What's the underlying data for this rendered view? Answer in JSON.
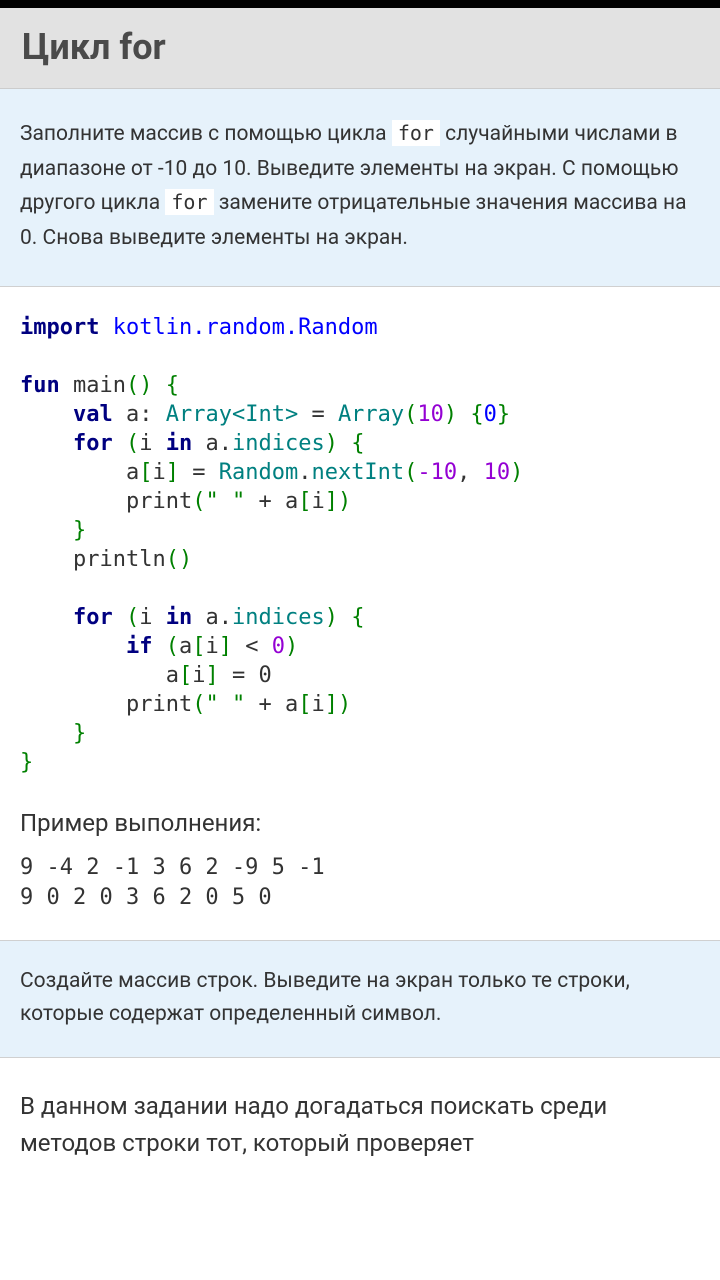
{
  "header": {
    "title": "Цикл for"
  },
  "task1": {
    "part1": "Заполните массив с помощью цикла ",
    "kw1": "for",
    "part2": " случайными числами в диапазоне от -10 до 10. Выведите элементы на экран. С помощью другого цикла ",
    "kw2": "for",
    "part3": " замените отрицательные значения массива на 0. Снова выведите элементы на экран."
  },
  "code": {
    "import": "import",
    "pkg": "kotlin.random.Random",
    "fun": "fun",
    "main": "main",
    "lp": "(",
    "rp": ")",
    "lb": "{",
    "rb": "}",
    "val": "val",
    "a": "a",
    "colon": ":",
    "ArrayInt": "Array<Int>",
    "eq": "=",
    "Array": "Array",
    "ten": "10",
    "zero": "0",
    "for": "for",
    "i": "i",
    "in": "in",
    "dot": ".",
    "indices": "indices",
    "Random": "Random",
    "nextInt": "nextInt",
    "negten": "-10",
    "comma": ",",
    "print": "print",
    "space_str": "\" \"",
    "plus": "+",
    "lbr": "[",
    "rbr": "]",
    "println": "println",
    "if": "if",
    "lt": "<",
    "zero_plain": "0"
  },
  "subtitle": "Пример выполнения:",
  "output": {
    "line1": "9 -4 2 -1 3 6 2 -9 5 -1",
    "line2": "9 0 2 0 3 6 2 0 5 0"
  },
  "task2": "Создайте массив строк. Выведите на экран только те строки, которые содержат определенный символ.",
  "explain": "В данном задании надо догадаться поискать среди методов строки тот, который проверяет"
}
